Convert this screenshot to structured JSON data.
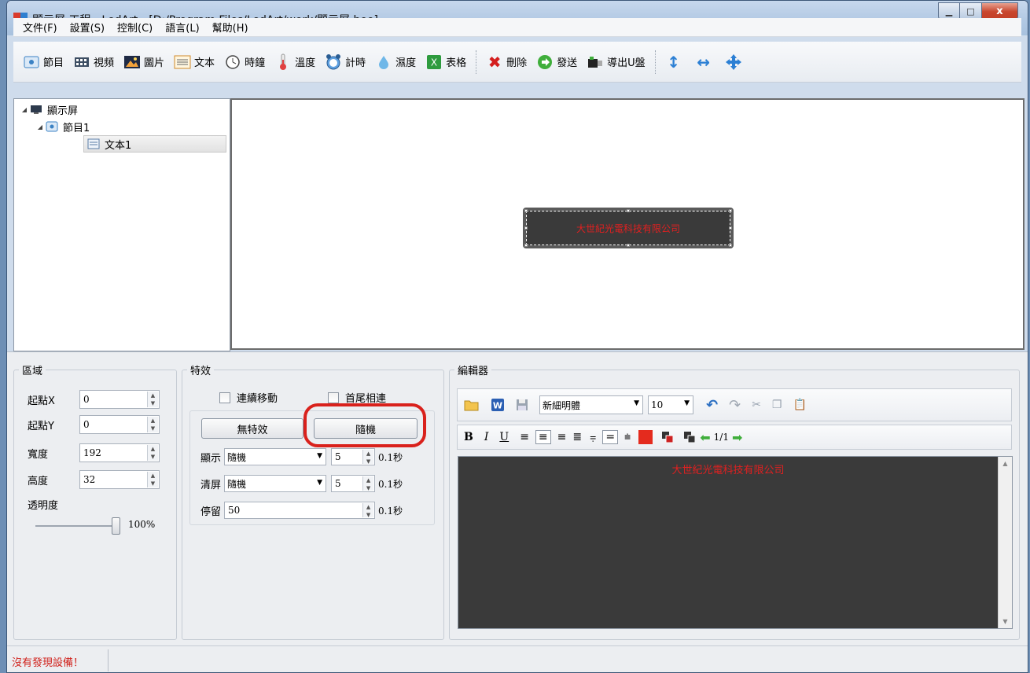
{
  "window": {
    "title": "顯示屏 工程 - LedArt - [D:/Program Files/LedArt/work/顯示屏.boo]",
    "controls": {
      "minimize": "▁",
      "maximize": "□",
      "close": "x"
    }
  },
  "menu": [
    "文件(F)",
    "設置(S)",
    "控制(C)",
    "語言(L)",
    "幫助(H)"
  ],
  "toolbar": {
    "program": "節目",
    "video": "視頻",
    "image": "圖片",
    "text": "文本",
    "clock": "時鐘",
    "temperature": "溫度",
    "timer": "計時",
    "humidity": "濕度",
    "table": "表格",
    "delete": "刪除",
    "send": "發送",
    "export_usb": "導出U盤"
  },
  "tree": {
    "root": "顯示屏",
    "program": "節目1",
    "text_item": "文本1"
  },
  "preview": {
    "led_text": "大世紀光電科技有限公司"
  },
  "area": {
    "title": "區域",
    "x_label": "起點X",
    "x_value": "0",
    "y_label": "起點Y",
    "y_value": "0",
    "width_label": "寬度",
    "width_value": "192",
    "height_label": "高度",
    "height_value": "32",
    "opacity_label": "透明度",
    "opacity_value": "100%",
    "opacity_percent": 100
  },
  "effects": {
    "title": "特效",
    "continuous_move": "連續移動",
    "head_tail": "首尾相連",
    "no_effect": "無特效",
    "random": "隨機",
    "display_label": "顯示",
    "display_value": "隨機",
    "display_speed": "5",
    "display_unit": "0.1秒",
    "clear_label": "清屏",
    "clear_value": "隨機",
    "clear_speed": "5",
    "clear_unit": "0.1秒",
    "stay_label": "停留",
    "stay_value": "50",
    "stay_unit": "0.1秒"
  },
  "editor": {
    "title": "編輯器",
    "font_name": "新細明體",
    "font_size": "10",
    "bold": "B",
    "italic": "I",
    "underline": "U",
    "page": "1/1",
    "content": "大世紀光電科技有限公司",
    "text_color": "#e02020"
  },
  "status": {
    "message": "沒有發現設備！"
  }
}
